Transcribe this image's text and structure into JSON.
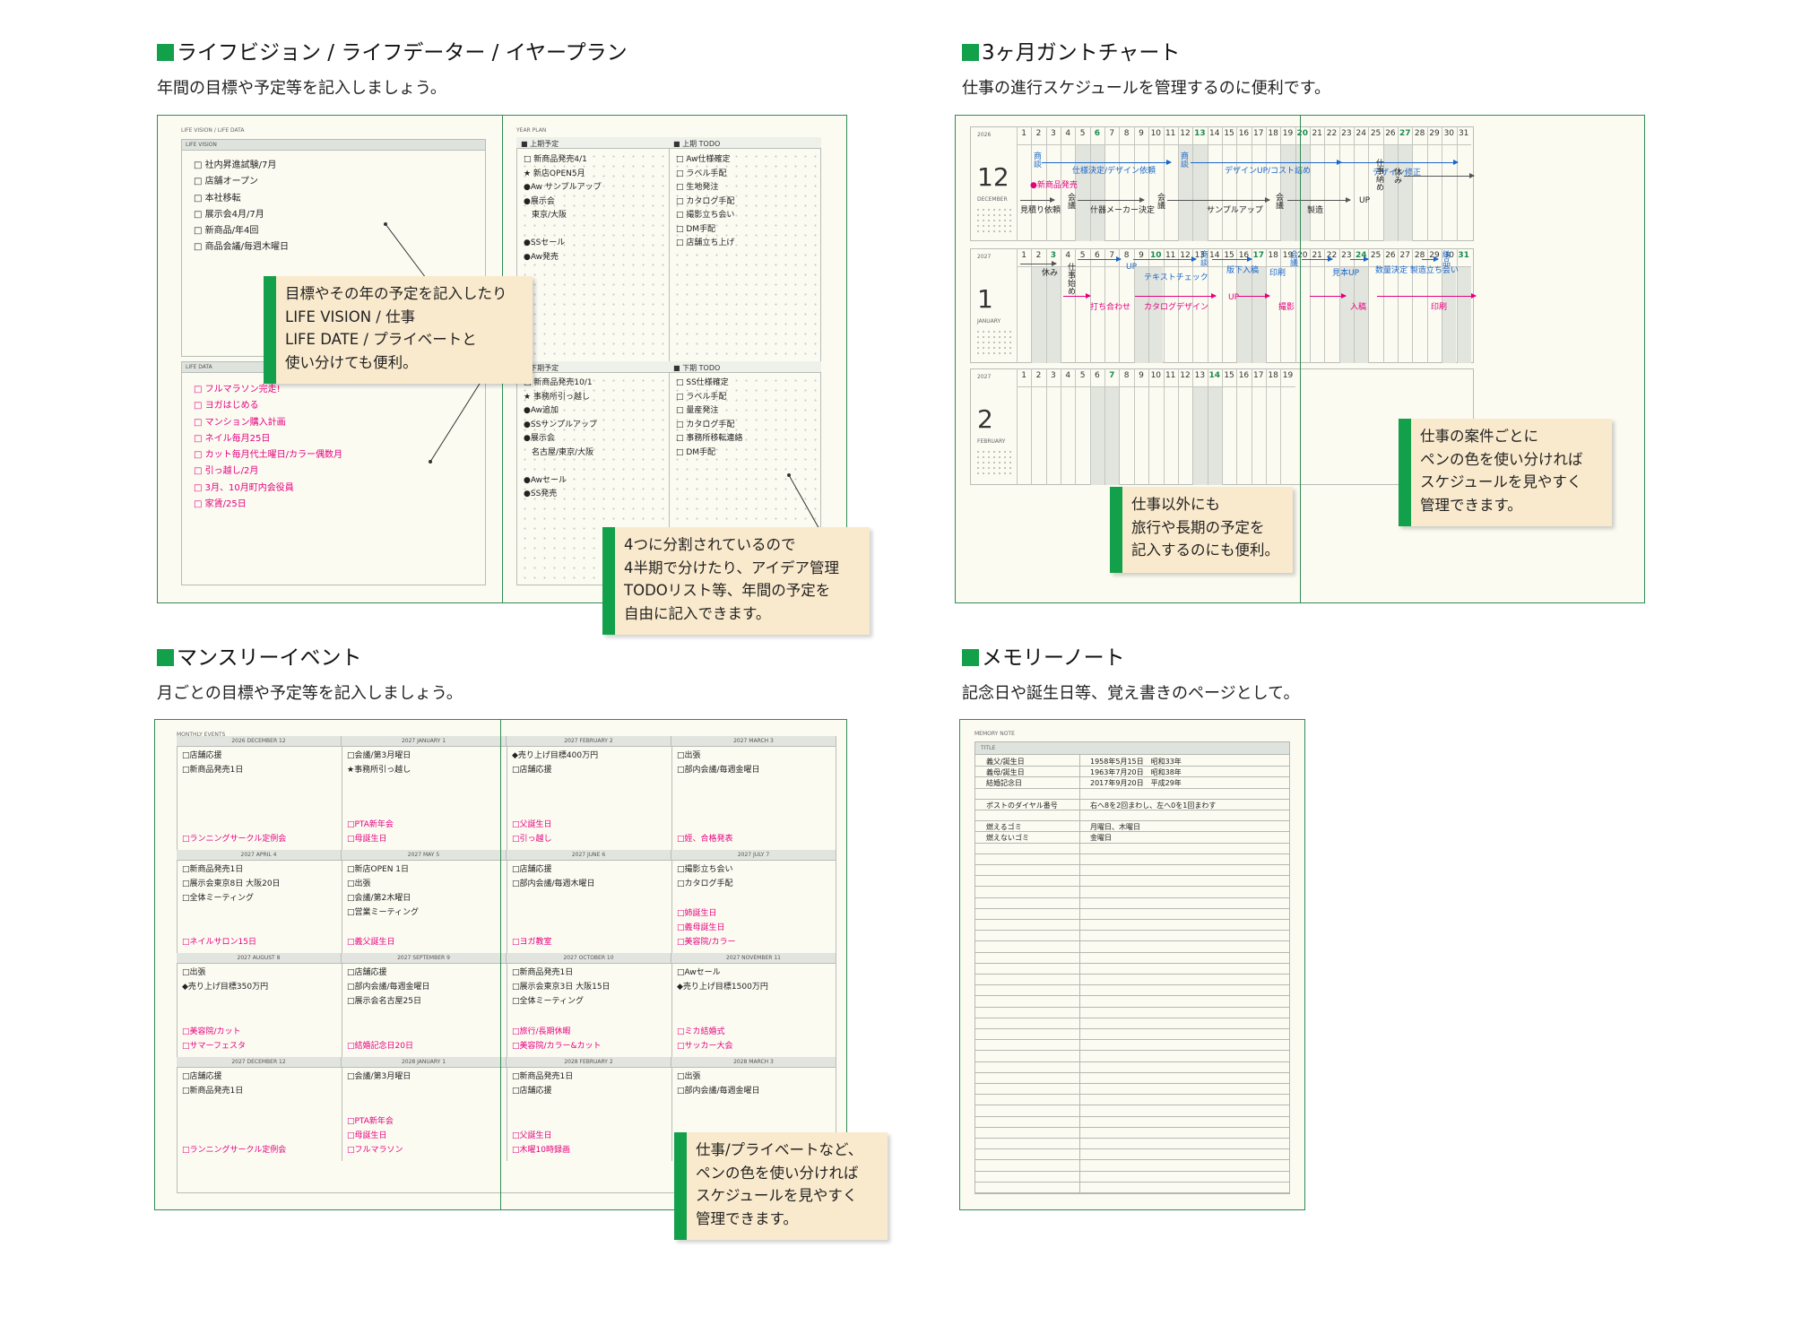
{
  "sections": {
    "life": {
      "title": "ライフビジョン / ライフデーター / イヤープラン",
      "subtitle": "年間の目標や予定等を記入しましょう。",
      "left_page_label": "LIFE VISION / LIFE DATA",
      "vision_label": "LIFE VISION",
      "data_label": "LIFE DATA",
      "vision_items": [
        "□ 社内昇進試験/7月",
        "□ 店舗オープン",
        "□ 本社移転",
        "□ 展示会4月/7月",
        "□ 新商品/年4回",
        "□ 商品会議/毎週木曜日"
      ],
      "data_items": [
        "□ フルマラソン完走!",
        "□ ヨガはじめる",
        "□ マンション購入計画",
        "□ ネイル毎月25日",
        "□ カット毎月代土曜日/カラー偶数月",
        "□ 引っ越し/2月",
        "□ 3月、10月町内会役員",
        "□ 家賃/25日"
      ],
      "right_page_label": "YEAR PLAN",
      "q1_label": "上期予定",
      "q2_label": "上期 TODO",
      "q3_label": "下期予定",
      "q4_label": "下期 TODO",
      "q1_items": [
        "□ 新商品発売4/1",
        "★ 新店OPEN5月",
        "●Aw サンプルアップ",
        "●展示会",
        "　東京/大阪",
        "",
        "●SSセール",
        "●Aw発売"
      ],
      "q2_items": [
        "□ Aw仕様確定",
        "□ ラベル手配",
        "□ 生地発注",
        "□ カタログ手配",
        "□ 撮影立ち会い",
        "□ DM手配",
        "□ 店舗立ち上げ"
      ],
      "q3_items": [
        "□ 新商品発売10/1",
        "★ 事務所引っ越し",
        "●Aw追加",
        "●SSサンプルアップ",
        "●展示会",
        "　名古屋/東京/大阪",
        "",
        "●Awセール",
        "●SS発売"
      ],
      "q4_items": [
        "□ SS仕様確定",
        "□ ラベル手配",
        "□ 量産発注",
        "□ カタログ手配",
        "□ 事務所移転連絡",
        "□ DM手配"
      ],
      "callout1": [
        "目標やその年の予定を記入したり",
        "LIFE VISION / 仕事",
        "LIFE DATE / プライベートと",
        "使い分けても便利。"
      ],
      "callout2": [
        "4つに分割されているので",
        "4半期で分けたり、アイデア管理",
        "TODOリスト等、年間の予定を",
        "自由に記入できます。"
      ]
    },
    "gantt": {
      "title": "3ヶ月ガントチャート",
      "subtitle": "仕事の進行スケジュールを管理するのに便利です。",
      "blocks": [
        {
          "year": "2026",
          "month": "12",
          "month_name": "DECEMBER"
        },
        {
          "year": "2027",
          "month": "1",
          "month_name": "JANUARY"
        },
        {
          "year": "2027",
          "month": "2",
          "month_name": "FEBRUARY"
        }
      ],
      "days": [
        "1",
        "2",
        "3",
        "4",
        "5",
        "6",
        "7",
        "8",
        "9",
        "10",
        "11",
        "12",
        "13",
        "14",
        "15",
        "16",
        "17",
        "18",
        "19",
        "20",
        "21",
        "22",
        "23",
        "24",
        "25",
        "26",
        "27",
        "28",
        "29",
        "30",
        "31"
      ],
      "dec_notes": {
        "a": "商談",
        "b": "仕様決定/デザイン依頼",
        "c": "商談",
        "d": "デザインUP/コスト詰め",
        "e": "デザイン修正",
        "f": "仕事納め",
        "g": "休み",
        "h": "●新商品発売",
        "i": "見積り依頼",
        "j": "会議",
        "k": "什器メーカー決定",
        "l": "会議",
        "m": "サンプルアップ",
        "n": "会議",
        "o": "製造",
        "p": "UP"
      },
      "jan_notes": {
        "a": "休み",
        "b": "仕事始め",
        "c": "UP",
        "d": "テキストチェック",
        "e": "商談",
        "f": "版下入稿",
        "g": "印刷",
        "h": "会議",
        "i": "見本UP",
        "j": "数量決定 製造立ち会い",
        "k": "納品",
        "l": "打ち合わせ",
        "m": "カタログデザイン",
        "n": "UP",
        "o": "撮影",
        "p": "入稿",
        "q": "印刷"
      },
      "callout1": [
        "仕事以外にも",
        "旅行や長期の予定を",
        "記入するのにも便利。"
      ],
      "callout2": [
        "仕事の案件ごとに",
        "ペンの色を使い分ければ",
        "スケジュールを見やすく",
        "管理できます。"
      ]
    },
    "monthly": {
      "title": "マンスリーイベント",
      "subtitle": "月ごとの目標や予定等を記入しましょう。",
      "page_label": "MONTHLY EVENTS",
      "months": [
        {
          "label": "2026 DECEMBER 12",
          "items": [
            "□店舗応援",
            "□新商品発売1日"
          ],
          "pink": [
            "□ランニングサークル定例会"
          ]
        },
        {
          "label": "2027 JANUARY 1",
          "items": [
            "□会議/第3月曜日",
            "★事務所引っ越し"
          ],
          "pink": [
            "□PTA新年会",
            "□母誕生日"
          ]
        },
        {
          "label": "2027 FEBRUARY 2",
          "items": [
            "◆売り上げ目標400万円",
            "□店舗応援"
          ],
          "pink": [
            "□父誕生日",
            "□引っ越し"
          ]
        },
        {
          "label": "2027 MARCH 3",
          "items": [
            "□出張",
            "□部内会議/毎週金曜日"
          ],
          "pink": [
            "□姪、合格発表"
          ]
        },
        {
          "label": "2027 APRIL 4",
          "items": [
            "□新商品発売1日",
            "□展示会東京8日 大阪20日",
            "□全体ミーティング"
          ],
          "pink": [
            "□ネイルサロン15日"
          ]
        },
        {
          "label": "2027 MAY 5",
          "items": [
            "□新店OPEN 1日",
            "□出張",
            "□会議/第2木曜日",
            "□営業ミーティング"
          ],
          "pink": [
            "□義父誕生日"
          ]
        },
        {
          "label": "2027 JUNE 6",
          "items": [
            "□店舗応援",
            "□部内会議/毎週木曜日"
          ],
          "pink": [
            "□ヨガ教室"
          ]
        },
        {
          "label": "2027 JULY 7",
          "items": [
            "□撮影立ち会い",
            "□カタログ手配"
          ],
          "pink": [
            "□姉誕生日",
            "□義母誕生日",
            "□美容院/カラー"
          ]
        },
        {
          "label": "2027 AUGUST 8",
          "items": [
            "□出張",
            "◆売り上げ目標350万円"
          ],
          "pink": [
            "□美容院/カット",
            "□サマーフェスタ"
          ]
        },
        {
          "label": "2027 SEPTEMBER 9",
          "items": [
            "□店舗応援",
            "□部内会議/毎週金曜日",
            "□展示会名古屋25日"
          ],
          "pink": [
            "□結婚記念日20日"
          ]
        },
        {
          "label": "2027 OCTOBER 10",
          "items": [
            "□新商品発売1日",
            "□展示会東京3日 大阪15日",
            "□全体ミーティング"
          ],
          "pink": [
            "□旅行/長期休暇",
            "□美容院/カラー&カット"
          ]
        },
        {
          "label": "2027 NOVEMBER 11",
          "items": [
            "□Awセール",
            "◆売り上げ目標1500万円"
          ],
          "pink": [
            "□ミカ結婚式",
            "□サッカー大会"
          ]
        },
        {
          "label": "2027 DECEMBER 12",
          "items": [
            "□店舗応援",
            "□新商品発売1日"
          ],
          "pink": [
            "□ランニングサークル定例会"
          ]
        },
        {
          "label": "2028 JANUARY 1",
          "items": [
            "□会議/第3月曜日"
          ],
          "pink": [
            "□PTA新年会",
            "□母誕生日",
            "□フルマラソン"
          ]
        },
        {
          "label": "2028 FEBRUARY 2",
          "items": [
            "□新商品発売1日",
            "□店舗応援"
          ],
          "pink": [
            "□父誕生日",
            "□木曜10時録画"
          ]
        },
        {
          "label": "2028 MARCH 3",
          "items": [
            "□出張",
            "□部内会議/毎週金曜日"
          ],
          "pink": []
        }
      ],
      "callout": [
        "仕事/プライベートなど、",
        "ペンの色を使い分ければ",
        "スケジュールを見やすく",
        "管理できます。"
      ]
    },
    "memory": {
      "title": "メモリーノート",
      "subtitle": "記念日や誕生日等、覚え書きのページとして。",
      "page_label": "MEMORY NOTE",
      "title_label": "TITLE",
      "rows": [
        {
          "k": "義父/誕生日",
          "v": "1958年5月15日　昭和33年"
        },
        {
          "k": "義母/誕生日",
          "v": "1963年7月20日　昭和38年"
        },
        {
          "k": "結婚記念日",
          "v": "2017年9月20日　平成29年"
        },
        {
          "k": "",
          "v": ""
        },
        {
          "k": "ポストのダイヤル番号",
          "v": "右へ8を2回まわし、左へ0を1回まわす"
        },
        {
          "k": "",
          "v": ""
        },
        {
          "k": "燃えるゴミ",
          "v": "月曜日、木曜日"
        },
        {
          "k": "燃えないゴミ",
          "v": "金曜日"
        }
      ]
    }
  },
  "colors": {
    "accent": "#12a04a",
    "frame": "#2e8c55",
    "paper": "#fbfbf2",
    "callout": "#faeacd",
    "pink": "#e6007e",
    "blue": "#1a66c9"
  }
}
